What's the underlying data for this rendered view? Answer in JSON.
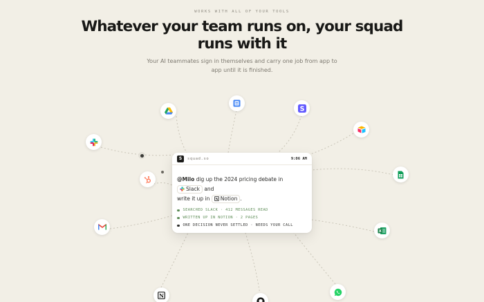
{
  "eyebrow": "WORKS WITH ALL OF YOUR TOOLS",
  "headline": "Whatever your team runs on, your squad runs with it",
  "subheadline": "Your AI teammates sign in themselves and carry one job from app to app until it is finished.",
  "integrations": [
    {
      "name": "Slack",
      "icon": "slack-icon"
    },
    {
      "name": "Google Drive",
      "icon": "google-drive-icon"
    },
    {
      "name": "Google Calendar",
      "icon": "google-calendar-icon"
    },
    {
      "name": "Stripe",
      "icon": "stripe-icon"
    },
    {
      "name": "Airtable",
      "icon": "airtable-icon"
    },
    {
      "name": "Google Sheets",
      "icon": "google-sheets-icon"
    },
    {
      "name": "HubSpot",
      "icon": "hubspot-icon"
    },
    {
      "name": "Gmail",
      "icon": "gmail-icon"
    },
    {
      "name": "Excel",
      "icon": "excel-icon"
    },
    {
      "name": "Notion",
      "icon": "notion-icon"
    },
    {
      "name": "GitHub",
      "icon": "github-icon"
    },
    {
      "name": "WhatsApp",
      "icon": "whatsapp-icon"
    }
  ],
  "card": {
    "logo": "S",
    "domain": "squad.so",
    "time": "9:06 AM",
    "mention": "@Milo",
    "text_1": "dig up the 2024 pricing debate in",
    "chip_1": "Slack",
    "text_2": "and",
    "text_3": "write it up in",
    "chip_2": "Notion",
    "text_4": ".",
    "status": [
      {
        "text": "SEARCHED SLACK · 412 MESSAGES READ",
        "state": "done"
      },
      {
        "text": "WRITTEN UP IN NOTION · 2 PAGES",
        "state": "done"
      },
      {
        "text": "ONE DECISION NEVER SETTLED · NEEDS YOUR CALL",
        "state": "pending"
      }
    ]
  },
  "colors": {
    "background": "#f2efe6",
    "done": "#5a8a53",
    "pending": "#2a2a28",
    "connector": "#c9c4b7"
  }
}
